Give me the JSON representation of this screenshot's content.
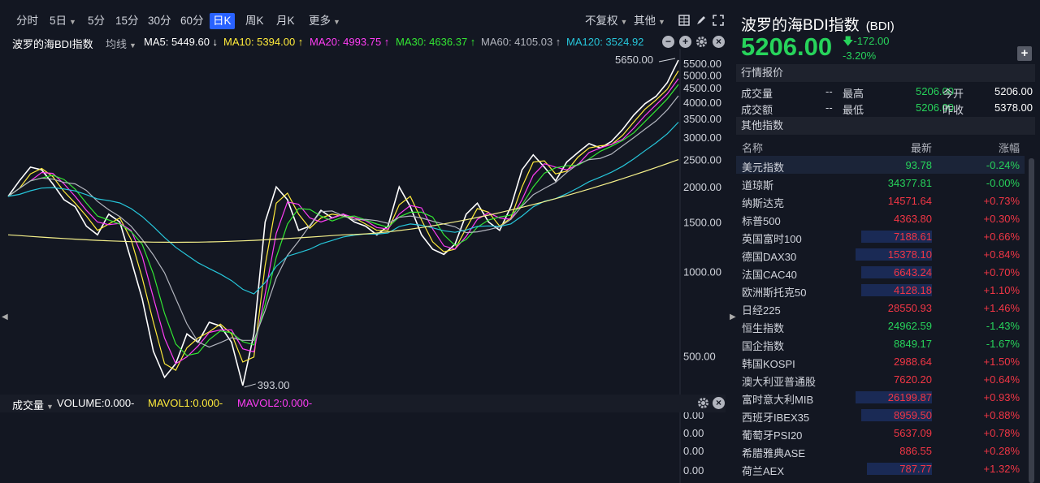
{
  "toolbar": {
    "periods": [
      "分时",
      "5日",
      "5分",
      "15分",
      "30分",
      "60分",
      "日K",
      "周K",
      "月K",
      "更多"
    ],
    "active_period": "日K",
    "adjust_label": "不复权",
    "other_label": "其他"
  },
  "ma_bar": {
    "name": "波罗的海BDI指数",
    "indicator": "均线",
    "ma5": "MA5: 5449.60 ↓",
    "ma10": "MA10: 5394.00 ↑",
    "ma20": "MA20: 4993.75 ↑",
    "ma30": "MA30: 4636.37 ↑",
    "ma60": "MA60: 4105.03 ↑",
    "ma120": "MA120: 3524.92",
    "colors": {
      "ma5": "#ffffff",
      "ma10": "#ffeb3b",
      "ma20": "#ff3df5",
      "ma30": "#33e633",
      "ma60": "#b2b5be",
      "ma120": "#26c6da",
      "long": "#f5f08a"
    }
  },
  "chart_data": {
    "type": "line",
    "scale": "log",
    "y_ticks": [
      "5500.00",
      "5000.00",
      "4500.00",
      "4000.00",
      "3500.00",
      "3000.00",
      "2500.00",
      "2000.00",
      "1500.00",
      "1000.00",
      "500.00"
    ],
    "y_tick_values": [
      5500,
      5000,
      4500,
      4000,
      3500,
      3000,
      2500,
      2000,
      1500,
      1000,
      500
    ],
    "high_label": "5650.00",
    "low_label": "393.00",
    "high_value": 5650,
    "low_value": 393,
    "ylim": [
      380,
      6200
    ],
    "price": [
      1850,
      2100,
      2350,
      2300,
      2050,
      1800,
      1700,
      1450,
      1350,
      1600,
      1500,
      1100,
      800,
      520,
      420,
      470,
      600,
      560,
      660,
      640,
      560,
      393,
      600,
      1500,
      2000,
      1800,
      1400,
      1450,
      1650,
      1550,
      1600,
      1500,
      1450,
      1350,
      1450,
      2000,
      1700,
      1350,
      1200,
      1150,
      1250,
      1600,
      1750,
      1500,
      1400,
      1700,
      2300,
      2600,
      2350,
      2100,
      2450,
      2650,
      2850,
      2750,
      2900,
      3200,
      3600,
      3950,
      4200,
      4700,
      5650
    ],
    "series_colors": [
      "#ffffff",
      "#ffeb3b",
      "#ff3df5",
      "#33e633",
      "#b2b5be",
      "#26c6da",
      "#f5f08a"
    ]
  },
  "volume": {
    "title": "成交量",
    "volume": "VOLUME:0.000-",
    "mavol1": "MAVOL1:0.000-",
    "mavol2": "MAVOL2:0.000-",
    "y_ticks": [
      "0.00",
      "0.00",
      "0.00",
      "0.00"
    ]
  },
  "quote": {
    "title": "波罗的海BDI指数",
    "code": "(BDI)",
    "price": "5206.00",
    "change": "-172.00",
    "pct": "-3.20%",
    "section_title": "行情报价",
    "rows": [
      {
        "l1": "成交量",
        "v1": "--",
        "l2": "最高",
        "v2": "5206.00",
        "l3": "今开",
        "v3": "5206.00"
      },
      {
        "l1": "成交额",
        "v1": "--",
        "l2": "最低",
        "v2": "5206.00",
        "l3": "昨收",
        "v3": "5378.00"
      }
    ]
  },
  "other_indices": {
    "section_title": "其他指数",
    "headers": [
      "名称",
      "最新",
      "涨幅"
    ],
    "rows": [
      {
        "name": "美元指数",
        "last": "93.78",
        "chg": "-0.24%",
        "dir": "dn",
        "hl": false
      },
      {
        "name": "道琼斯",
        "last": "34377.81",
        "chg": "-0.00%",
        "dir": "dn",
        "hl": false
      },
      {
        "name": "纳斯达克",
        "last": "14571.64",
        "chg": "+0.73%",
        "dir": "up",
        "hl": false
      },
      {
        "name": "标普500",
        "last": "4363.80",
        "chg": "+0.30%",
        "dir": "up",
        "hl": false
      },
      {
        "name": "英国富时100",
        "last": "7188.61",
        "chg": "+0.66%",
        "dir": "up",
        "hl": true
      },
      {
        "name": "德国DAX30",
        "last": "15378.10",
        "chg": "+0.84%",
        "dir": "up",
        "hl": true
      },
      {
        "name": "法国CAC40",
        "last": "6643.24",
        "chg": "+0.70%",
        "dir": "up",
        "hl": true
      },
      {
        "name": "欧洲斯托克50",
        "last": "4128.18",
        "chg": "+1.10%",
        "dir": "up",
        "hl": true
      },
      {
        "name": "日经225",
        "last": "28550.93",
        "chg": "+1.46%",
        "dir": "up",
        "hl": false
      },
      {
        "name": "恒生指数",
        "last": "24962.59",
        "chg": "-1.43%",
        "dir": "dn",
        "hl": false
      },
      {
        "name": "国企指数",
        "last": "8849.17",
        "chg": "-1.67%",
        "dir": "dn",
        "hl": false
      },
      {
        "name": "韩国KOSPI",
        "last": "2988.64",
        "chg": "+1.50%",
        "dir": "up",
        "hl": false
      },
      {
        "name": "澳大利亚普通股",
        "last": "7620.20",
        "chg": "+0.64%",
        "dir": "up",
        "hl": false
      },
      {
        "name": "富时意大利MIB",
        "last": "26199.87",
        "chg": "+0.93%",
        "dir": "up",
        "hl": true
      },
      {
        "name": "西班牙IBEX35",
        "last": "8959.50",
        "chg": "+0.88%",
        "dir": "up",
        "hl": true
      },
      {
        "name": "葡萄牙PSI20",
        "last": "5637.09",
        "chg": "+0.78%",
        "dir": "up",
        "hl": false
      },
      {
        "name": "希腊雅典ASE",
        "last": "886.55",
        "chg": "+0.28%",
        "dir": "up",
        "hl": false
      },
      {
        "name": "荷兰AEX",
        "last": "787.77",
        "chg": "+1.32%",
        "dir": "up",
        "hl": true
      }
    ]
  }
}
